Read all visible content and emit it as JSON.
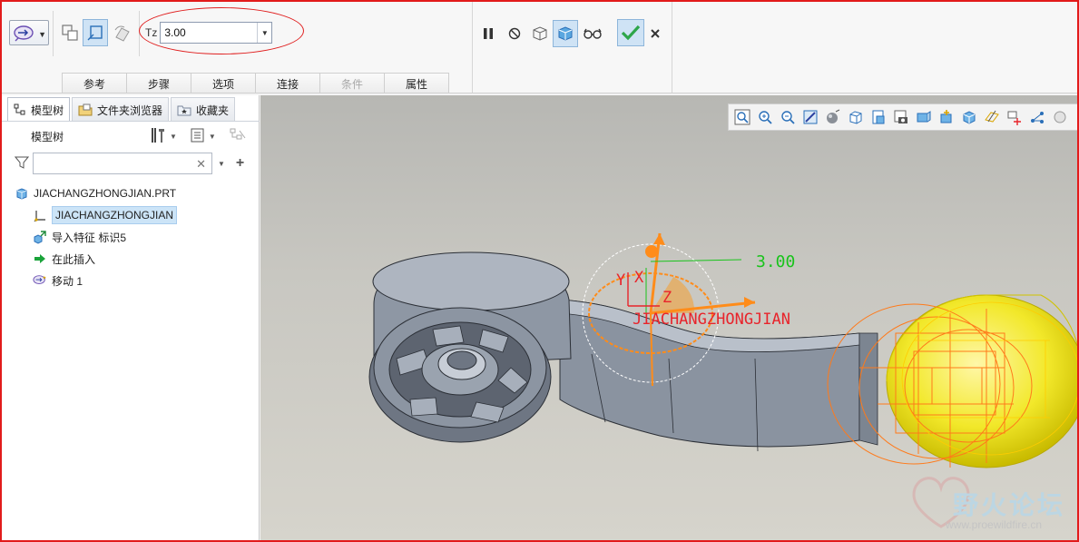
{
  "ribbon": {
    "tz_label": "Tz",
    "tz_value": "3.00",
    "tabs": [
      {
        "label": "参考",
        "enabled": true
      },
      {
        "label": "步骤",
        "enabled": true
      },
      {
        "label": "选项",
        "enabled": true
      },
      {
        "label": "连接",
        "enabled": true
      },
      {
        "label": "条件",
        "enabled": false
      },
      {
        "label": "属性",
        "enabled": true
      }
    ],
    "accent_confirm": "#2ea64a",
    "annotation_color": "#e02020"
  },
  "panel": {
    "tabs": [
      {
        "label": "模型树",
        "icon": "model-tree-icon",
        "active": true
      },
      {
        "label": "文件夹浏览器",
        "icon": "folder-browser-icon",
        "active": false
      },
      {
        "label": "收藏夹",
        "icon": "favorites-icon",
        "active": false
      }
    ],
    "tree_header": "模型树",
    "filter_placeholder": "",
    "items": [
      {
        "label": "JIACHANGZHONGJIAN.PRT",
        "icon": "part-icon",
        "level": 0,
        "selected": false
      },
      {
        "label": "JIACHANGZHONGJIAN",
        "icon": "csys-icon",
        "level": 1,
        "selected": true
      },
      {
        "label": "导入特征 标识5",
        "icon": "import-feature-icon",
        "level": 1,
        "selected": false
      },
      {
        "label": "在此插入",
        "icon": "insert-here-arrow-icon",
        "level": 1,
        "selected": false
      },
      {
        "label": "移动 1",
        "icon": "move-feature-icon",
        "level": 1,
        "selected": false
      }
    ]
  },
  "viewport": {
    "dimension_value": "3.00",
    "csys_name": "JIACHANGZHONGJIAN",
    "axis_labels": {
      "x": "X",
      "y": "Y",
      "z": "Z"
    },
    "watermark_cn": "野火论坛",
    "watermark_url": "www.proewildfire.cn"
  }
}
